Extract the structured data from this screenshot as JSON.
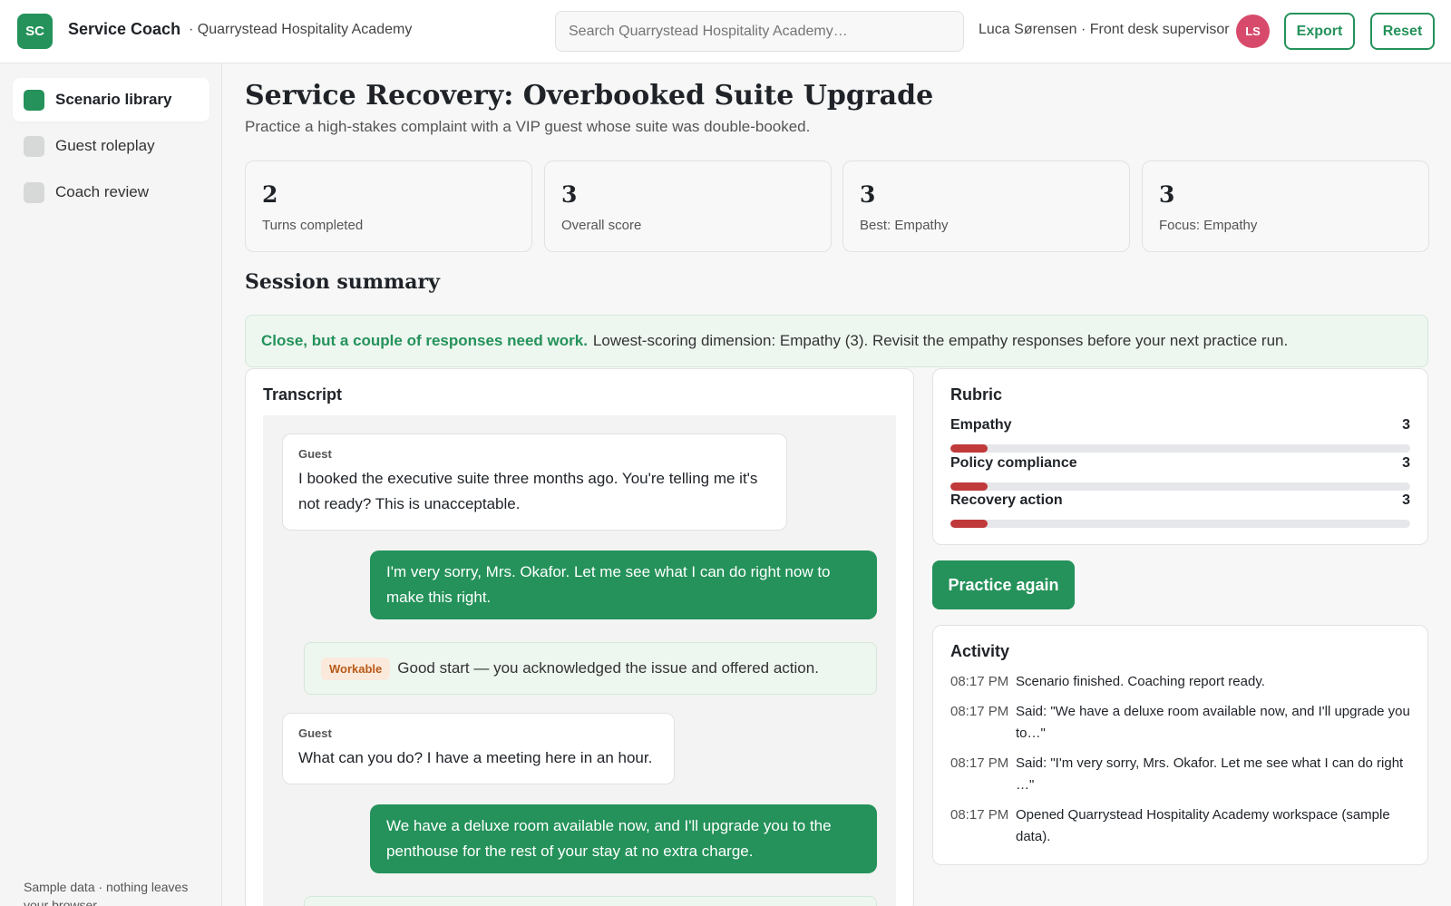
{
  "header": {
    "logo_initials": "SC",
    "app_name": "Service Coach",
    "org_name": "· Quarrystead Hospitality Academy",
    "search_placeholder": "Search Quarrystead Hospitality Academy…",
    "user_label": "Luca Sørensen · Front desk supervisor",
    "avatar_initials": "LS",
    "export_label": "Export",
    "reset_label": "Reset"
  },
  "sidebar": {
    "items": [
      {
        "label": "Scenario library",
        "active": true
      },
      {
        "label": "Guest roleplay",
        "active": false
      },
      {
        "label": "Coach review",
        "active": false
      }
    ],
    "footer": "Sample data · nothing leaves your browser"
  },
  "main": {
    "title": "Service Recovery: Overbooked Suite Upgrade",
    "subtitle": "Practice a high-stakes complaint with a VIP guest whose suite was double-booked.",
    "stats": [
      {
        "value": "2",
        "label": "Turns completed"
      },
      {
        "value": "3",
        "label": "Overall score"
      },
      {
        "value": "3",
        "label": "Best: Empathy"
      },
      {
        "value": "3",
        "label": "Focus: Empathy"
      }
    ],
    "summary_title": "Session summary",
    "banner": {
      "strong": "Close, but a couple of responses need work.",
      "text": "Lowest-scoring dimension: Empathy (3). Revisit the empathy responses before your next practice run."
    }
  },
  "transcript": {
    "title": "Transcript",
    "messages": [
      {
        "who": "Guest",
        "text": "I booked the executive suite three months ago. You're telling me it's not ready? This is unacceptable."
      },
      {
        "text": "I'm very sorry, Mrs. Okafor. Let me see what I can do right now to make this right."
      },
      {
        "badge": "Workable",
        "text": "Good start — you acknowledged the issue and offered action."
      },
      {
        "who": "Guest",
        "text": "What can you do? I have a meeting here in an hour."
      },
      {
        "text": "We have a deluxe room available now, and I'll upgrade you to the penthouse for the rest of your stay at no extra charge."
      }
    ]
  },
  "rubric": {
    "title": "Rubric",
    "max": 10,
    "items": [
      {
        "label": "Empathy",
        "value": "3",
        "fraction": 0.08
      },
      {
        "label": "Policy compliance",
        "value": "3",
        "fraction": 0.08
      },
      {
        "label": "Recovery action",
        "value": "3",
        "fraction": 0.08
      }
    ],
    "fill_color": "#c0393b"
  },
  "practice_label": "Practice again",
  "activity": {
    "title": "Activity",
    "items": [
      {
        "time": "08:17 PM",
        "text": "Scenario finished. Coaching report ready."
      },
      {
        "time": "08:17 PM",
        "text": "Said: \"We have a deluxe room available now, and I'll upgrade you to…\""
      },
      {
        "time": "08:17 PM",
        "text": "Said: \"I'm very sorry, Mrs. Okafor. Let me see what I can do right …\""
      },
      {
        "time": "08:17 PM",
        "text": "Opened Quarrystead Hospitality Academy workspace (sample data)."
      }
    ]
  },
  "colors": {
    "accent": "#24925a",
    "avatar": "#d84a6b",
    "badge_text": "#b85a17"
  }
}
